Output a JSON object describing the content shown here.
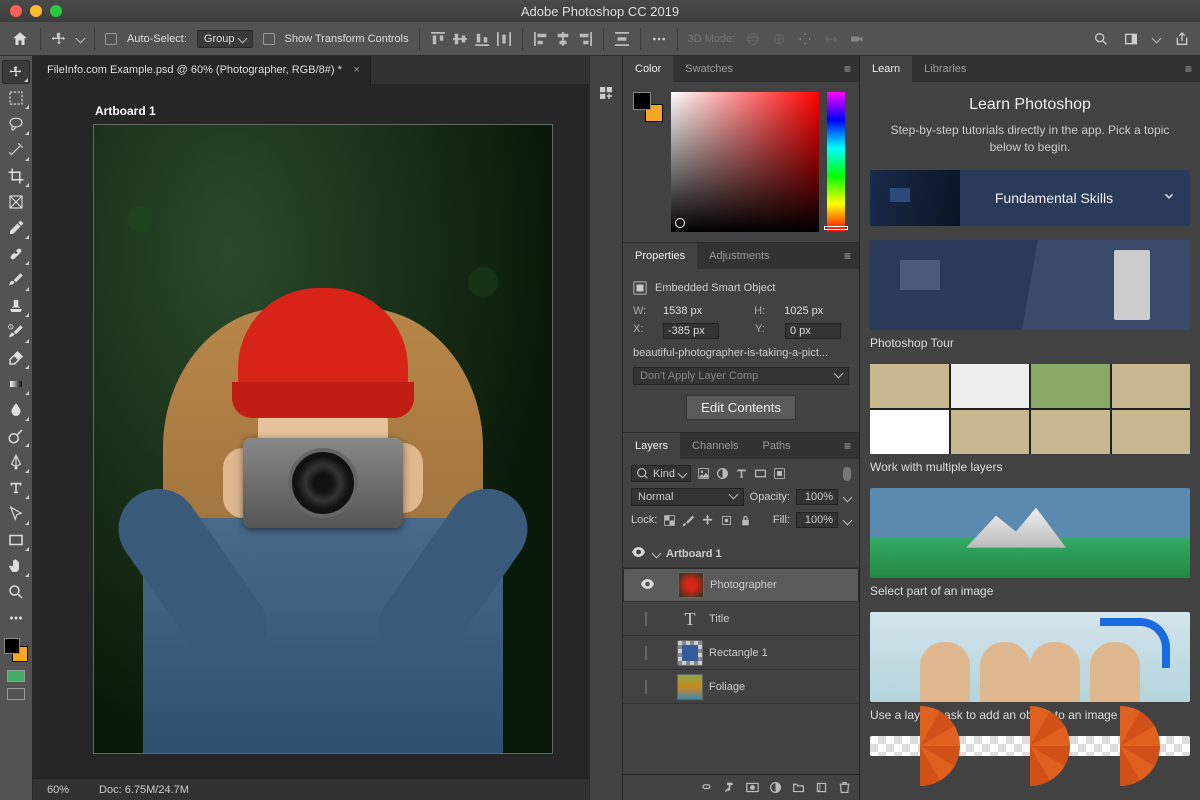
{
  "app_title": "Adobe Photoshop CC 2019",
  "options_bar": {
    "auto_select_label": "Auto-Select:",
    "auto_select_value": "Group",
    "show_transform_label": "Show Transform Controls",
    "mode_3d_label": "3D Mode:"
  },
  "document": {
    "tab_title": "FileInfo.com Example.psd @ 60% (Photographer, RGB/8#) *",
    "artboard_label": "Artboard 1",
    "zoom": "60%",
    "doc_size": "Doc: 6.75M/24.7M"
  },
  "panels": {
    "color": {
      "tab_color": "Color",
      "tab_swatches": "Swatches"
    },
    "props": {
      "tab_properties": "Properties",
      "tab_adjustments": "Adjustments",
      "type_label": "Embedded Smart Object",
      "w_label": "W:",
      "w_value": "1538 px",
      "h_label": "H:",
      "h_value": "1025 px",
      "x_label": "X:",
      "x_value": "-385 px",
      "y_label": "Y:",
      "y_value": "0 px",
      "smartobj_name": "beautiful-photographer-is-taking-a-pict...",
      "layer_comp": "Don't Apply Layer Comp",
      "edit_btn": "Edit Contents"
    },
    "layers": {
      "tab_layers": "Layers",
      "tab_channels": "Channels",
      "tab_paths": "Paths",
      "kind_label": "Kind",
      "blend_mode": "Normal",
      "opacity_label": "Opacity:",
      "opacity_value": "100%",
      "lock_label": "Lock:",
      "fill_label": "Fill:",
      "fill_value": "100%",
      "items": [
        {
          "name": "Artboard 1",
          "group": true
        },
        {
          "name": "Photographer"
        },
        {
          "name": "Title"
        },
        {
          "name": "Rectangle 1"
        },
        {
          "name": "Foliage"
        }
      ]
    },
    "learn": {
      "tab_learn": "Learn",
      "tab_libraries": "Libraries",
      "title": "Learn Photoshop",
      "subtitle": "Step-by-step tutorials directly in the app. Pick a topic below to begin.",
      "fundamental": "Fundamental Skills",
      "tutorials": [
        "Photoshop Tour",
        "Work with multiple layers",
        "Select part of an image",
        "Use a layer mask to add an object to an image"
      ]
    }
  }
}
